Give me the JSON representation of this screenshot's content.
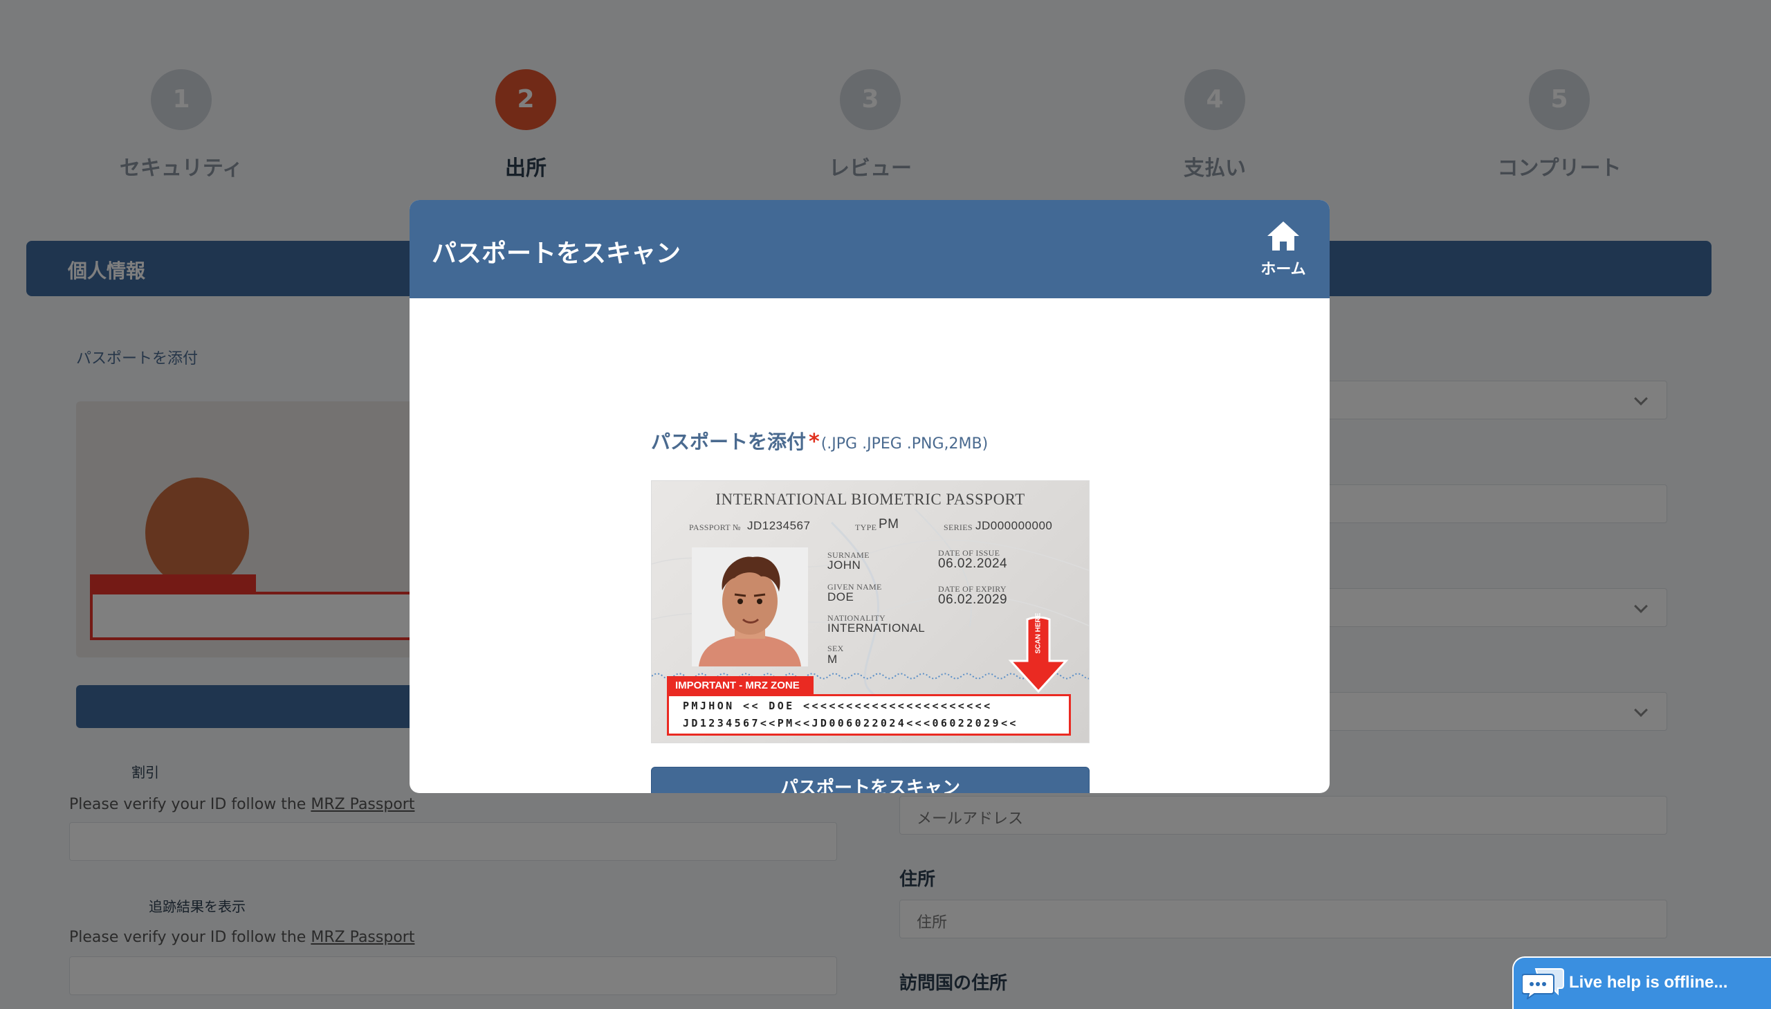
{
  "stepper": {
    "steps": [
      {
        "number": "1",
        "label": "セキュリティ"
      },
      {
        "number": "2",
        "label": "出所"
      },
      {
        "number": "3",
        "label": "レビュー"
      },
      {
        "number": "4",
        "label": "支払い"
      },
      {
        "number": "5",
        "label": "コンプリート"
      }
    ]
  },
  "background": {
    "section_header": "個人情報",
    "passport_label": "パスポートを添付",
    "check1_label": "割引",
    "check2_label": "追跡結果を表示",
    "help_text": "Please verify your ID follow the",
    "help_link": "MRZ Passport",
    "input_email_placeholder": "メールアドレス",
    "right_label_1": "住所",
    "right_input_1": "住所",
    "right_label_2": "訪問国の住所"
  },
  "modal": {
    "title": "パスポートをスキャン",
    "home_label": "ホーム",
    "attach_label": "パスポートを添付",
    "required_mark": "*",
    "formats": "(.JPG .JPEG .PNG,2MB)",
    "scan_button": "パスポートをスキャン"
  },
  "passport": {
    "title": "INTERNATIONAL BIOMETRIC PASSPORT",
    "passport_no_label": "PASSPORT №",
    "passport_no": "JD1234567",
    "type_label": "TYPE",
    "type": "PM",
    "series_label": "SERIES",
    "series": "JD000000000",
    "surname_label": "SURNAME",
    "surname": "JOHN",
    "given_name_label": "GIVEN NAME",
    "given_name": "DOE",
    "nationality_label": "NATIONALITY",
    "nationality": "INTERNATIONAL",
    "sex_label": "SEX",
    "sex": "M",
    "issue_label": "DATE OF ISSUE",
    "issue_date": "06.02.2024",
    "expiry_label": "DATE OF EXPIRY",
    "expiry_date": "06.02.2029",
    "mrz_tag": "IMPORTANT - MRZ ZONE",
    "scan_here": "SCAN HERE",
    "mrz_line1": "PMJHON << DOE <<<<<<<<<<<<<<<<<<<<<<",
    "mrz_line2": "JD1234567<<PM<<JD006022024<<<06022029<<"
  },
  "live_help": {
    "text": "Live help is offline..."
  },
  "colors": {
    "modal_header": "#426995",
    "active_step": "#e2542f",
    "required": "#e0301e",
    "mrz_red": "#ea2a22",
    "live_help": "#3a8fe0"
  }
}
